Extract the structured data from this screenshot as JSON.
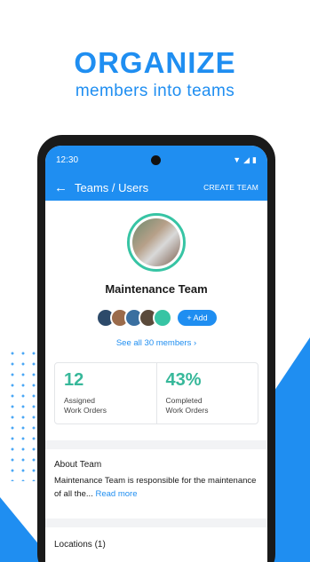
{
  "promo": {
    "headline": "ORGANIZE",
    "subheadline": "members into teams"
  },
  "colors": {
    "brand_blue": "#1f8ef1",
    "teal": "#37c4a4"
  },
  "status_bar": {
    "time": "12:30"
  },
  "app_bar": {
    "back_icon": "arrow-left-icon",
    "title": "Teams / Users",
    "action": "CREATE TEAM"
  },
  "team": {
    "name": "Maintenance Team",
    "add_label": "+ Add",
    "see_all": "See all 30 members  ›"
  },
  "stats": [
    {
      "value": "12",
      "label_line1": "Assigned",
      "label_line2": "Work Orders"
    },
    {
      "value": "43%",
      "label_line1": "Completed",
      "label_line2": "Work Orders"
    }
  ],
  "about": {
    "title": "About Team",
    "text": "Maintenance Team is responsible for the maintenance of all the... ",
    "read_more": "Read more"
  },
  "locations": {
    "title": "Locations (1)"
  }
}
